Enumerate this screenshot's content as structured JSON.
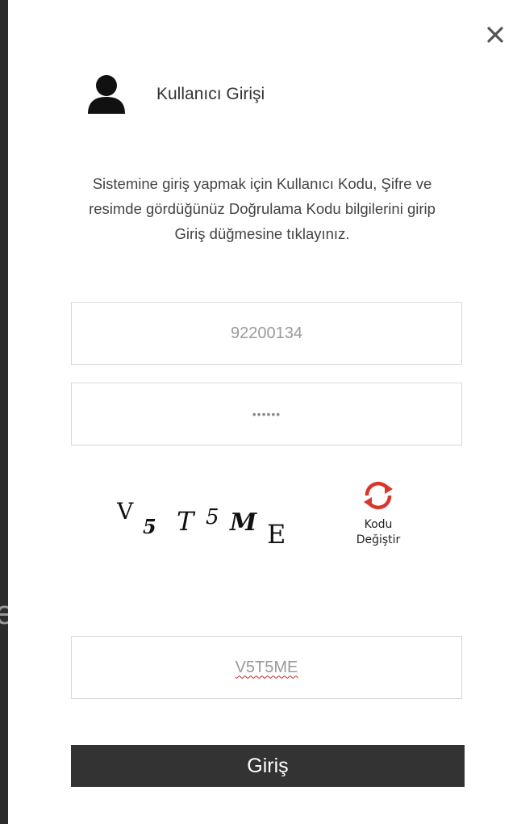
{
  "modal": {
    "title": "Kullanıcı Girişi",
    "instructions": "Sistemine giriş yapmak için Kullanıcı Kodu, Şifre ve resimde gördüğünüz Doğrulama Kodu bilgilerini girip Giriş düğmesine tıklayınız.",
    "user_code_value": "92200134",
    "password_mask": "••••••",
    "captcha_text": "V5T5ME",
    "refresh_label_line1": "Kodu",
    "refresh_label_line2": "Değiştir",
    "captcha_input_value": "V5T5ME",
    "login_label": "Giriş"
  },
  "icons": {
    "close": "close-icon",
    "user": "user-icon",
    "refresh": "refresh-icon"
  },
  "colors": {
    "button_bg": "#333333",
    "refresh_red": "#d9362c",
    "field_border": "#d8d8d8"
  }
}
